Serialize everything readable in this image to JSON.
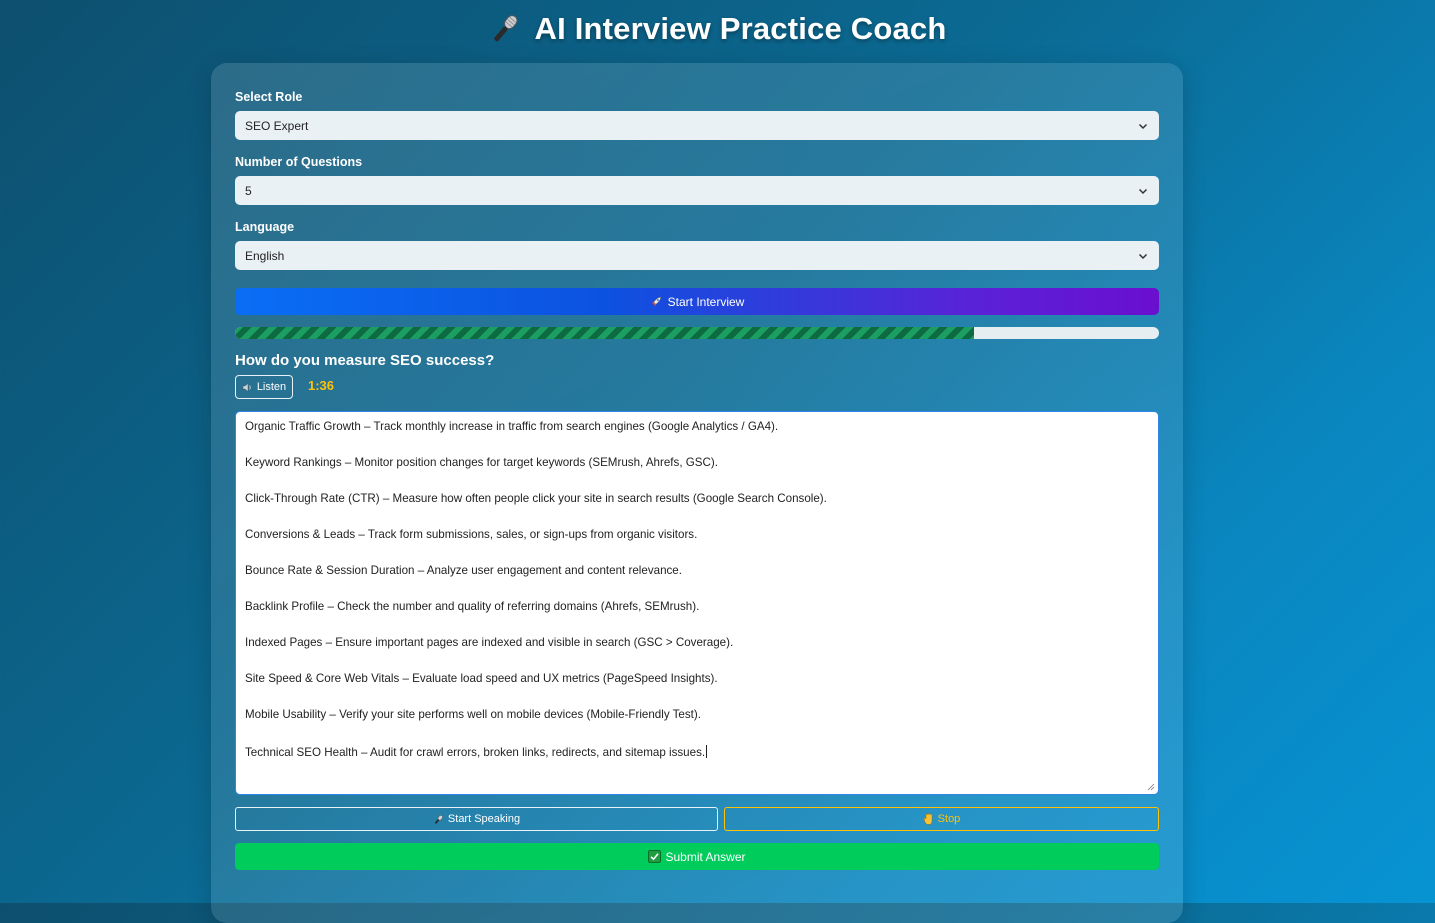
{
  "header": {
    "title": "AI Interview Practice Coach",
    "icon": "microphone-icon"
  },
  "form": {
    "role": {
      "label": "Select Role",
      "value": "SEO Expert"
    },
    "questions": {
      "label": "Number of Questions",
      "value": "5"
    },
    "language": {
      "label": "Language",
      "value": "English"
    }
  },
  "start_button": {
    "label": "Start Interview",
    "icon": "rocket-icon"
  },
  "progress": {
    "fraction": 0.8
  },
  "question": {
    "text": "How do you measure SEO success?"
  },
  "listen_button": {
    "label": "Listen",
    "icon": "speaker-icon"
  },
  "timer": {
    "value": "1:36"
  },
  "answer": {
    "lines": [
      "Organic Traffic Growth – Track monthly increase in traffic from search engines (Google Analytics / GA4).",
      "Keyword Rankings – Monitor position changes for target keywords (SEMrush, Ahrefs, GSC).",
      "Click-Through Rate (CTR) – Measure how often people click your site in search results (Google Search Console).",
      "Conversions & Leads – Track form submissions, sales, or sign-ups from organic visitors.",
      "Bounce Rate & Session Duration – Analyze user engagement and content relevance.",
      "Backlink Profile – Check the number and quality of referring domains (Ahrefs, SEMrush).",
      "Indexed Pages – Ensure important pages are indexed and visible in search (GSC > Coverage).",
      "Site Speed & Core Web Vitals – Evaluate load speed and UX metrics (PageSpeed Insights).",
      "Mobile Usability – Verify your site performs well on mobile devices (Mobile-Friendly Test).",
      "Technical SEO Health – Audit for crawl errors, broken links, redirects, and sitemap issues."
    ]
  },
  "speak_button": {
    "label": "Start Speaking",
    "icon": "microphone-icon"
  },
  "stop_button": {
    "label": "Stop",
    "icon": "hand-icon"
  },
  "submit_button": {
    "label": "Submit Answer",
    "icon": "checkmark-icon"
  },
  "colors": {
    "accent_timer": "#ffc107",
    "submit": "#00cc5c",
    "progress": "#1c9e62"
  }
}
